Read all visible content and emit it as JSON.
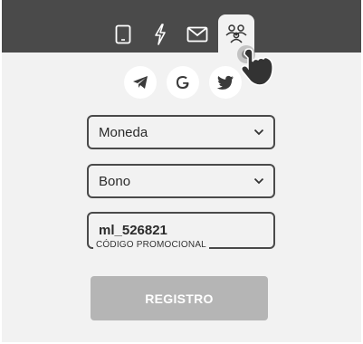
{
  "tabs": [
    {
      "icon": "phone-icon"
    },
    {
      "icon": "lightning-icon"
    },
    {
      "icon": "mail-icon"
    },
    {
      "icon": "people-icon",
      "active": true
    }
  ],
  "social": [
    {
      "icon": "telegram-icon"
    },
    {
      "icon": "google-icon"
    },
    {
      "icon": "twitter-icon"
    }
  ],
  "form": {
    "currency": {
      "value": "Moneda"
    },
    "bonus": {
      "value": "Bono"
    },
    "promo": {
      "value": "ml_526821",
      "label": "CÓDIGO PROMOCIONAL"
    },
    "submit_label": "REGISTRO"
  },
  "colors": {
    "topbar": "#4a4a4a",
    "panel": "#f2f2f2",
    "button": "#b5b5b5"
  }
}
